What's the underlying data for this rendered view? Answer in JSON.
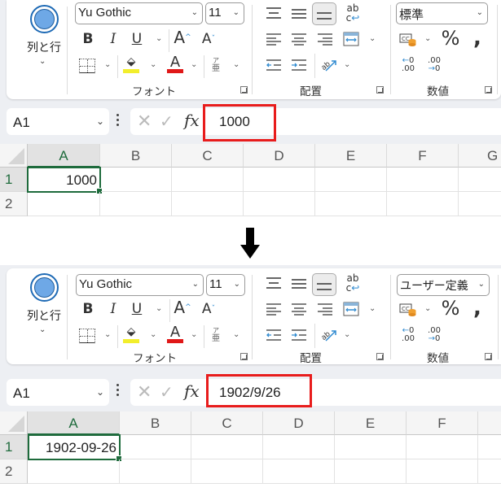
{
  "colors": {
    "accent_green": "#1e6b3c",
    "highlight_red": "#e81c1c",
    "fill_yellow": "#f2ee2b",
    "font_red": "#e01818",
    "icon_blue": "#2f8ad0"
  },
  "panels": [
    {
      "ribbon": {
        "rows_cols_button": {
          "label": "列と行",
          "icon": "circle-icon"
        },
        "font_group": {
          "font_name": "Yu Gothic",
          "font_size": "11",
          "bold": "B",
          "italic": "I",
          "underline": "U",
          "grow_font": "A",
          "shrink_font": "A",
          "font_color_glyph": "A",
          "phonetic_glyph_top": "ア",
          "phonetic_glyph_bottom": "亜",
          "label": "フォント"
        },
        "alignment_group": {
          "label": "配置",
          "wrap_top": "ab",
          "wrap_bottom": "c"
        },
        "number_group": {
          "format": "標準",
          "percent": "%",
          "comma": "❟",
          "inc_decimal_top": "0",
          "inc_decimal_bottom": ".00",
          "dec_decimal_top": ".00",
          "dec_decimal_bottom": "0",
          "label": "数値"
        }
      },
      "formula_bar": {
        "name_box": "A1",
        "fx": "fx",
        "value": "1000"
      },
      "grid": {
        "columns": [
          "A",
          "B",
          "C",
          "D",
          "E",
          "F",
          "G"
        ],
        "rows": [
          "1",
          "2"
        ],
        "cells": {
          "A1": "1000"
        },
        "active_cell": "A1"
      }
    },
    {
      "ribbon": {
        "rows_cols_button": {
          "label": "列と行",
          "icon": "circle-icon"
        },
        "font_group": {
          "font_name": "Yu Gothic",
          "font_size": "11",
          "bold": "B",
          "italic": "I",
          "underline": "U",
          "grow_font": "A",
          "shrink_font": "A",
          "font_color_glyph": "A",
          "phonetic_glyph_top": "ア",
          "phonetic_glyph_bottom": "亜",
          "label": "フォント"
        },
        "alignment_group": {
          "label": "配置",
          "wrap_top": "ab",
          "wrap_bottom": "c"
        },
        "number_group": {
          "format": "ユーザー定義",
          "percent": "%",
          "comma": "❟",
          "inc_decimal_top": "0",
          "inc_decimal_bottom": ".00",
          "dec_decimal_top": ".00",
          "dec_decimal_bottom": "0",
          "label": "数値"
        }
      },
      "formula_bar": {
        "name_box": "A1",
        "fx": "fx",
        "value": "1902/9/26"
      },
      "grid": {
        "columns": [
          "A",
          "B",
          "C",
          "D",
          "E",
          "F"
        ],
        "rows": [
          "1",
          "2"
        ],
        "cells": {
          "A1": "1902-09-26"
        },
        "active_cell": "A1"
      }
    }
  ],
  "transition_arrow": "down-arrow-icon"
}
